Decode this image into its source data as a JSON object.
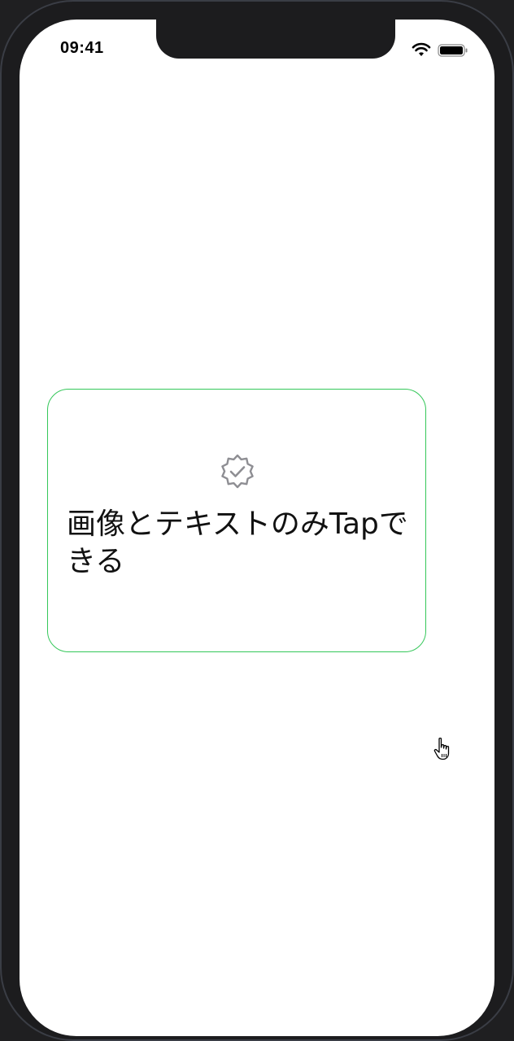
{
  "status_bar": {
    "time": "09:41",
    "icons": [
      "wifi-icon",
      "battery-icon"
    ]
  },
  "card": {
    "icon": "checkmark-seal-icon",
    "text": "画像とテキストのみTapできる",
    "border_color": "#34c759"
  },
  "overlay": {
    "pointer": "hand-pointer-cursor-icon"
  }
}
